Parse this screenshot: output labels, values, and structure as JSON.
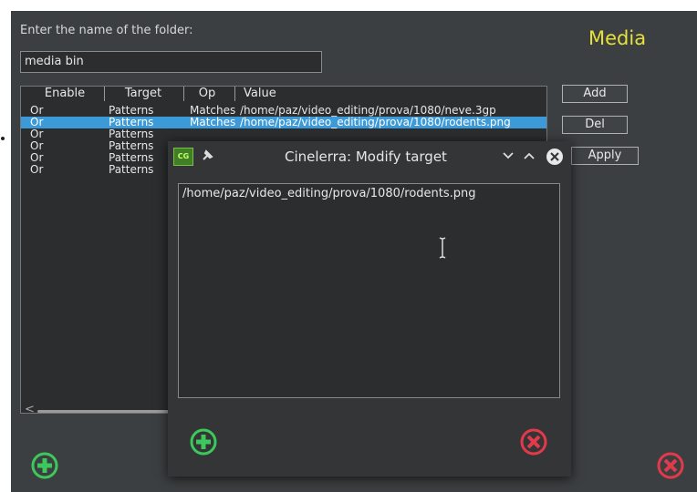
{
  "main": {
    "prompt": "Enter the name of the folder:",
    "title": "Media",
    "folder_name": "media bin",
    "columns": [
      "Enable",
      "Target",
      "Op",
      "Value"
    ],
    "rows": [
      {
        "enable": "Or",
        "target": "Patterns",
        "op": "Matches",
        "value": "/home/paz/video_editing/prova/1080/neve.3gp"
      },
      {
        "enable": "Or",
        "target": "Patterns",
        "op": "Matches",
        "value": "/home/paz/video_editing/prova/1080/rodents.png"
      },
      {
        "enable": "Or",
        "target": "Patterns",
        "op": "",
        "value": ""
      },
      {
        "enable": "Or",
        "target": "Patterns",
        "op": "",
        "value": ""
      },
      {
        "enable": "Or",
        "target": "Patterns",
        "op": "",
        "value": ""
      },
      {
        "enable": "Or",
        "target": "Patterns",
        "op": "",
        "value": ""
      }
    ],
    "add_label": "Add",
    "del_label": "Del",
    "apply_label": "Apply",
    "scroll_left_glyph": "<"
  },
  "dialog": {
    "title": "Cinelerra: Modify target",
    "app_icon_text": "CG",
    "value": "/home/paz/video_editing/prova/1080/rodents.png"
  },
  "colors": {
    "ok_green": "#3cc85a",
    "cancel_red": "#e23a4a",
    "selection": "#3d9ad9",
    "title_yellow": "#e6e03a"
  },
  "icons": {
    "ok": "plus-circle-icon",
    "cancel": "x-circle-icon",
    "pin": "pin-icon",
    "minimize": "chevron-down-icon",
    "maximize": "chevron-up-icon",
    "close": "close-circle-icon",
    "text_cursor": "text-cursor-icon"
  }
}
